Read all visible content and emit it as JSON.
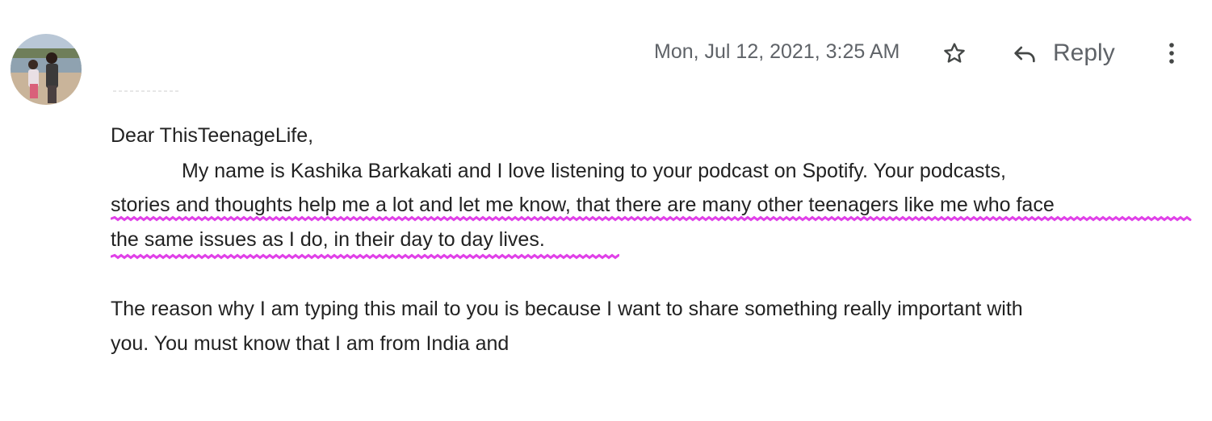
{
  "header": {
    "date": "Mon, Jul 12, 2021, 3:25 AM",
    "reply_label": "Reply",
    "star_icon": "star-outline-icon",
    "reply_icon": "reply-arrow-icon",
    "more_icon": "more-vert-icon"
  },
  "message": {
    "greeting": "Dear ThisTeenageLife,",
    "paragraph1_line1": "My name is Kashika Barkakati and I love listening to your podcast on Spotify. Your podcasts,",
    "paragraph1_line2": "stories and thoughts help me a lot and let me know, that there are many other teenagers like me who face",
    "paragraph1_line3": "the same issues as I do, in their day to day lives.",
    "paragraph2_line1": "The reason why I am typing this mail to you is because I want to share something really important with",
    "paragraph2_line2": "you. You must know that I am from India and"
  },
  "colors": {
    "highlight_underline": "#e040e8",
    "meta_text": "#5f6368",
    "body_text": "#222222"
  }
}
